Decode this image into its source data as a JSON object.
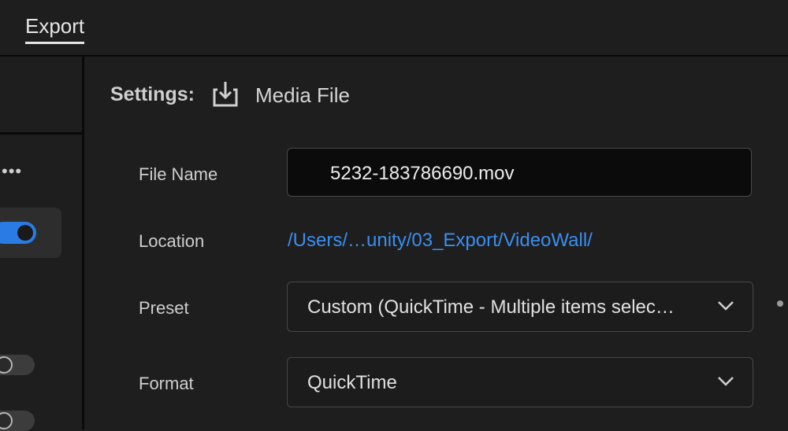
{
  "header": {
    "tab_label": "Export"
  },
  "left_panel": {
    "more_label": "•••"
  },
  "settings": {
    "label": "Settings:",
    "media_label": "Media File",
    "media_icon": "download-icon"
  },
  "form": {
    "file_name_label": "File Name",
    "file_name_value": "5232-183786690.mov",
    "location_label": "Location",
    "location_value": "/Users/…unity/03_Export/VideoWall/",
    "preset_label": "Preset",
    "preset_value": "Custom (QuickTime - Multiple items selec…",
    "format_label": "Format",
    "format_value": "QuickTime"
  },
  "colors": {
    "accent": "#2b7be4",
    "link": "#3b8ef0",
    "background": "#1e1e1e"
  }
}
